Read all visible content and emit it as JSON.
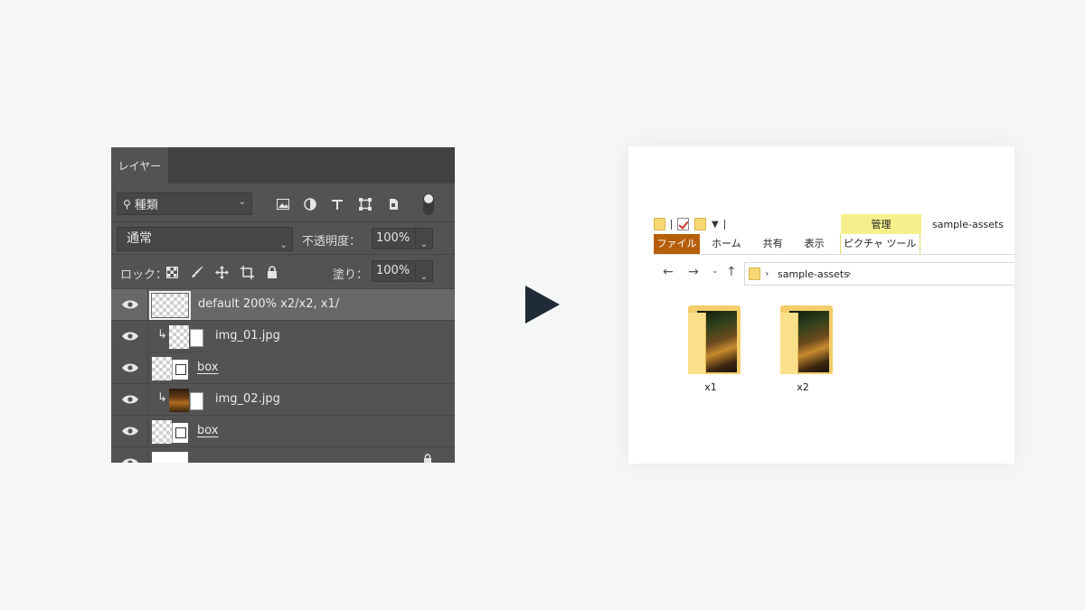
{
  "photoshop_panel": {
    "tab": "レイヤー",
    "filter": {
      "label": "種類",
      "icons": [
        "image-filter-icon",
        "adjustment-filter-icon",
        "type-filter-icon",
        "shape-filter-icon",
        "smart-object-filter-icon"
      ]
    },
    "blend_mode": "通常",
    "opacity_label": "不透明度：",
    "opacity_value": "100%",
    "lock_label": "ロック：",
    "lock_icons": [
      "lock-transparent-icon",
      "lock-paint-icon",
      "lock-move-icon",
      "lock-artboard-icon",
      "lock-all-icon"
    ],
    "fill_label": "塗り：",
    "fill_value": "100%",
    "layers": [
      {
        "name": "default 200% x2/x2, x1/",
        "selected": true,
        "type": "group-artboard"
      },
      {
        "name": "img_01.jpg",
        "clipped": true,
        "type": "smart-object"
      },
      {
        "name": "box",
        "type": "shape"
      },
      {
        "name": "img_02.jpg",
        "clipped": true,
        "type": "smart-object"
      },
      {
        "name": "box",
        "type": "shape"
      }
    ]
  },
  "explorer_window": {
    "title": "sample-assets",
    "manage_tab": "管理",
    "ribbon_tabs": [
      "ファイル",
      "ホーム",
      "共有",
      "表示",
      "ピクチャ ツール"
    ],
    "address": {
      "breadcrumb": "sample-assets"
    },
    "folders": [
      {
        "name": "x1"
      },
      {
        "name": "x2"
      }
    ]
  },
  "colors": {
    "ps_bg": "#535353",
    "ps_tabbar": "#424242",
    "arrow": "#1f2b36",
    "file_tab": "#b65e0a",
    "manage_tab": "#f5f08c",
    "folder": "#f3cd6a"
  }
}
